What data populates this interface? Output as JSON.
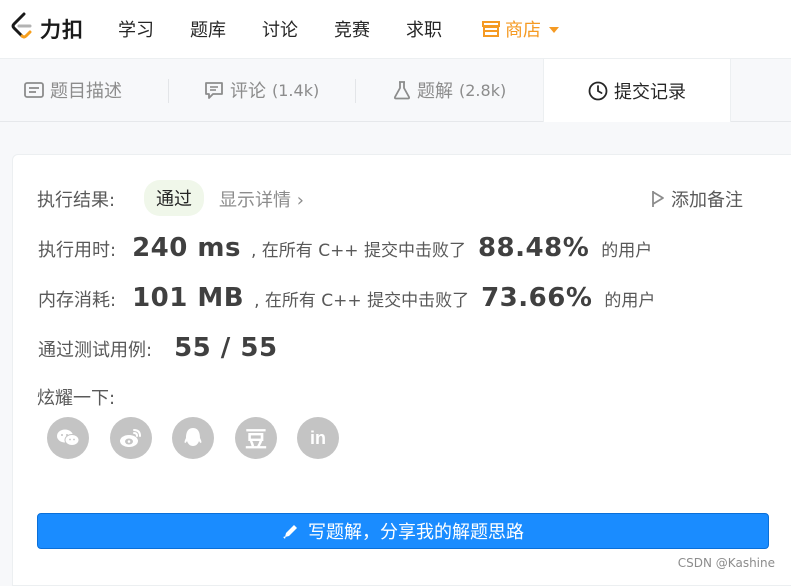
{
  "nav": {
    "logo_text": "力扣",
    "items": [
      "学习",
      "题库",
      "讨论",
      "竞赛",
      "求职"
    ],
    "store": "商店"
  },
  "tabs": [
    {
      "label": "题目描述",
      "count": "",
      "icon": "description-icon"
    },
    {
      "label": "评论",
      "count": "(1.4k)",
      "icon": "comment-icon"
    },
    {
      "label": "题解",
      "count": "(2.8k)",
      "icon": "flask-icon"
    },
    {
      "label": "提交记录",
      "count": "",
      "icon": "clock-icon"
    }
  ],
  "result": {
    "label": "执行结果:",
    "status": "通过",
    "detail": "显示详情 ›",
    "add_note": "添加备注"
  },
  "runtime": {
    "label": "执行用时:",
    "value": "240 ms",
    "text": ", 在所有 C++ 提交中击败了",
    "percent": "88.48%",
    "suffix": "的用户"
  },
  "memory": {
    "label": "内存消耗:",
    "value": "101 MB",
    "text": ", 在所有 C++ 提交中击败了",
    "percent": "73.66%",
    "suffix": "的用户"
  },
  "testcases": {
    "label": "通过测试用例:",
    "value": "55 / 55"
  },
  "share": {
    "label": "炫耀一下:",
    "icons": [
      "wechat-icon",
      "weibo-icon",
      "qq-icon",
      "douban-icon",
      "linkedin-icon"
    ],
    "linkedin_text": "in",
    "douban_text": "豆"
  },
  "cta": {
    "label": "写题解，分享我的解题思路"
  },
  "watermark": "CSDN @Kashine",
  "colors": {
    "accent": "#1a8cff",
    "store": "#f59a23",
    "pass_bg": "#f0f7ea"
  }
}
